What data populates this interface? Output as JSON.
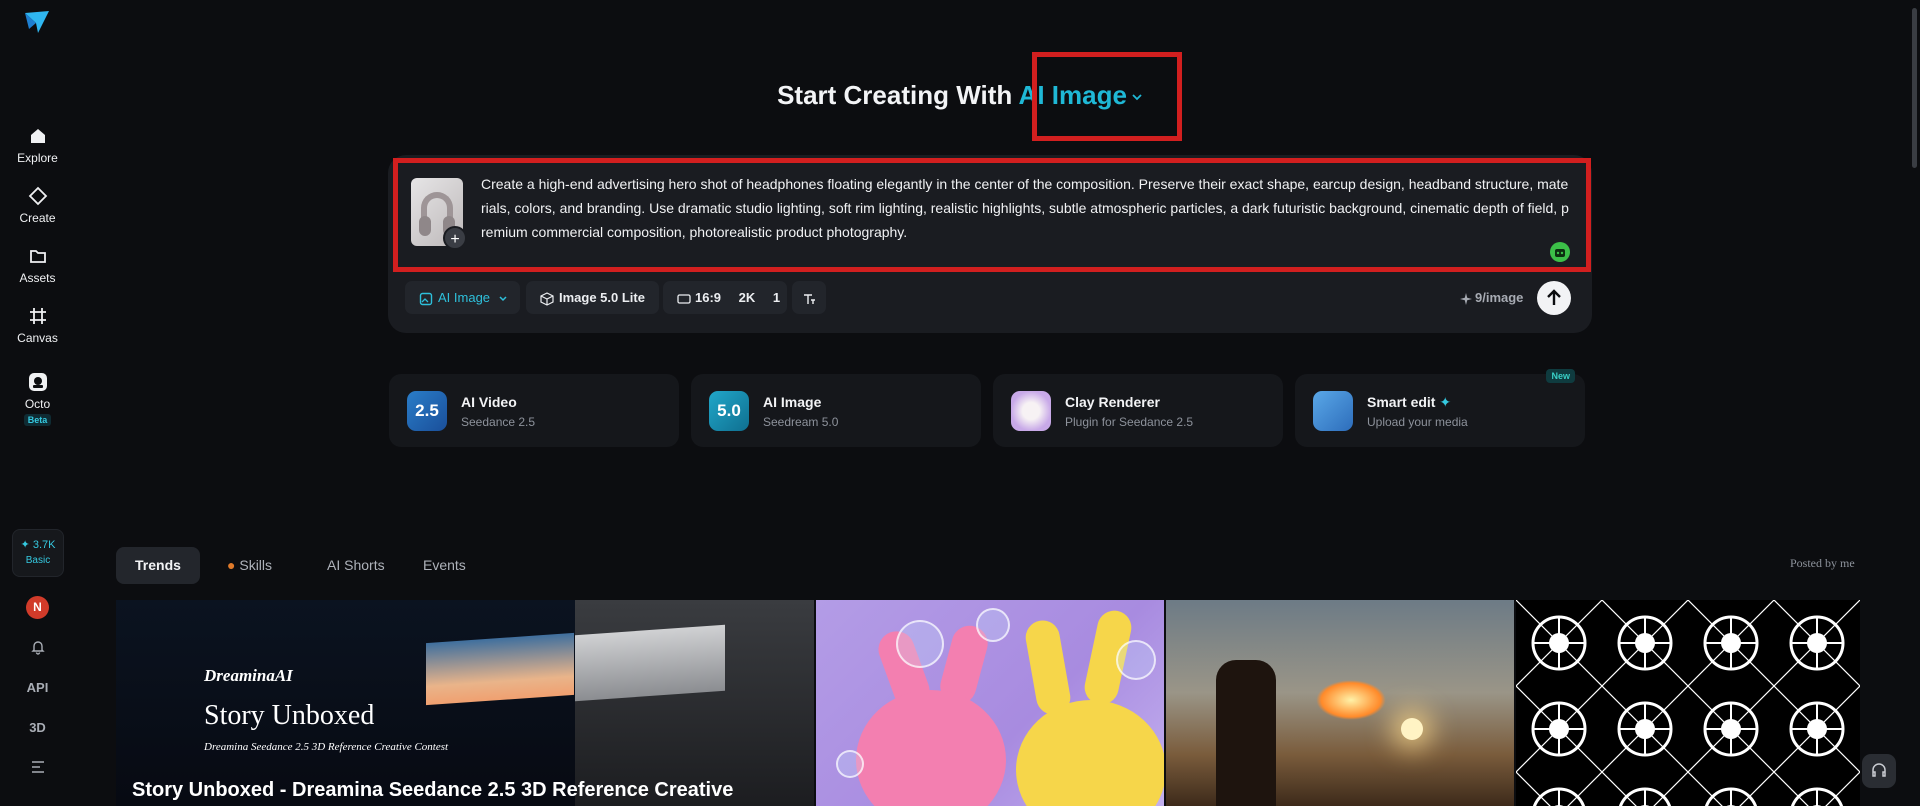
{
  "sidebar": {
    "items": [
      {
        "label": "Explore"
      },
      {
        "label": "Create"
      },
      {
        "label": "Assets"
      },
      {
        "label": "Canvas"
      },
      {
        "label": "Octo",
        "badge": "Beta"
      }
    ],
    "credits": {
      "amount": "✦ 3.7K",
      "plan": "Basic"
    },
    "avatar_initial": "N",
    "api_label": "API",
    "three_d_label": "3D"
  },
  "header": {
    "title_prefix": "Start Creating With",
    "mode": "AI Image"
  },
  "prompt": {
    "text": "Create a high-end advertising hero shot of  headphones floating elegantly in the center of the composition. Preserve their exact shape, earcup design, headband structure, materials, colors, and branding. Use dramatic studio lighting, soft rim lighting, realistic highlights, subtle atmospheric particles, a dark futuristic background, cinematic depth of field, premium commercial composition, photorealistic product photography.",
    "toolbar": {
      "mode": "AI Image",
      "model": "Image 5.0 Lite",
      "ratio": "16:9",
      "resolution": "2K",
      "count": "1",
      "cost": "9/image"
    }
  },
  "features": [
    {
      "title": "AI Video",
      "subtitle": "Seedance 2.5",
      "icon_text": "2.5"
    },
    {
      "title": "AI Image",
      "subtitle": "Seedream 5.0",
      "icon_text": "5.0"
    },
    {
      "title": "Clay Renderer",
      "subtitle": "Plugin for Seedance 2.5"
    },
    {
      "title": "Smart edit",
      "subtitle": "Upload your media",
      "badge": "New"
    }
  ],
  "tabs": [
    {
      "label": "Trends",
      "active": true
    },
    {
      "label": "Skills"
    },
    {
      "label": "AI Shorts"
    },
    {
      "label": "Events"
    }
  ],
  "posted_by": "Posted by me",
  "gallery": {
    "card1": {
      "brand": "DreaminaAI",
      "title": "Story Unboxed",
      "subtitle": "Dreamina Seedance 2.5 3D Reference Creative Contest",
      "caption": "Story Unboxed - Dreamina Seedance 2.5 3D Reference Creative"
    }
  },
  "colors": {
    "accent": "#1fb8d6",
    "highlight_box": "#d21f1f",
    "background": "#0c0d10"
  }
}
